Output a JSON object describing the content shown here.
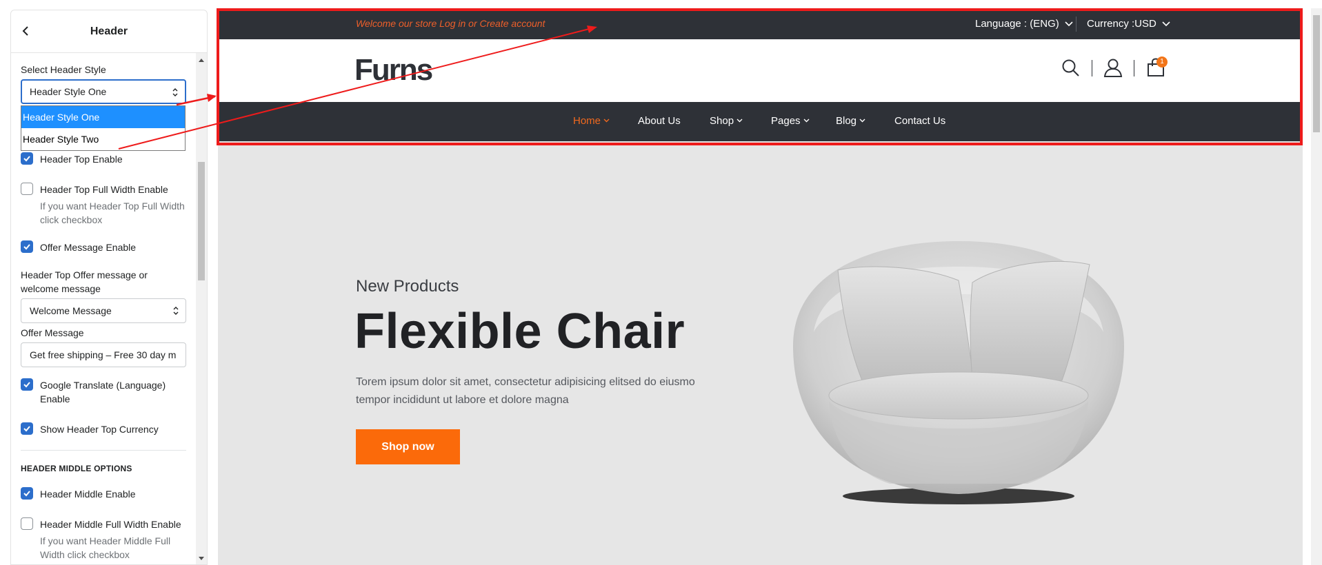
{
  "panel": {
    "title": "Header",
    "select_header_style_label": "Select Header Style",
    "select_header_style_value": "Header Style One",
    "dropdown_options": [
      "Header Style One",
      "Header Style Two"
    ],
    "header_top_enable": "Header Top Enable",
    "header_top_full_width_enable": "Header Top Full Width Enable",
    "header_top_full_width_help": "If you want Header Top Full Width click checkbox",
    "offer_message_enable": "Offer Message Enable",
    "offer_or_welcome_label": "Header Top Offer message or welcome message",
    "offer_or_welcome_value": "Welcome Message",
    "offer_message_label": "Offer Message",
    "offer_message_value": "Get free shipping  – Free 30 day m",
    "google_translate_enable": "Google Translate (Language) Enable",
    "show_header_top_currency": "Show Header Top Currency",
    "header_middle_options": "HEADER MIDDLE OPTIONS",
    "header_middle_enable": "Header Middle Enable",
    "header_middle_full_width_enable": "Header Middle Full Width Enable",
    "header_middle_full_width_help": "If you want Header Middle Full Width click checkbox",
    "checkboxes": {
      "header_top_enable": true,
      "header_top_full_width_enable": false,
      "offer_message_enable": true,
      "google_translate_enable": true,
      "show_header_top_currency": true,
      "header_middle_enable": true,
      "header_middle_full_width_enable": false
    }
  },
  "store": {
    "welcome_text": "Welcome our store Log in or Create account",
    "language": "Language : (ENG)",
    "currency": "Currency :USD",
    "logo": "Furns",
    "cart_count": "1",
    "nav": [
      "Home",
      "About Us",
      "Shop",
      "Pages",
      "Blog",
      "Contact Us"
    ],
    "hero_subtitle": "New Products",
    "hero_title": "Flexible Chair",
    "hero_text": "Torem ipsum dolor sit amet, consectetur adipisicing elitsed do eiusmo tempor incididunt ut labore et dolore magna",
    "shop_button": "Shop now"
  },
  "colors": {
    "accent_orange": "#fb6a0a",
    "dark_bar": "#2e3137",
    "highlight_red": "#ee1b1b",
    "checkbox_blue": "#2c6ecb",
    "dropdown_selected": "#1e90ff"
  }
}
